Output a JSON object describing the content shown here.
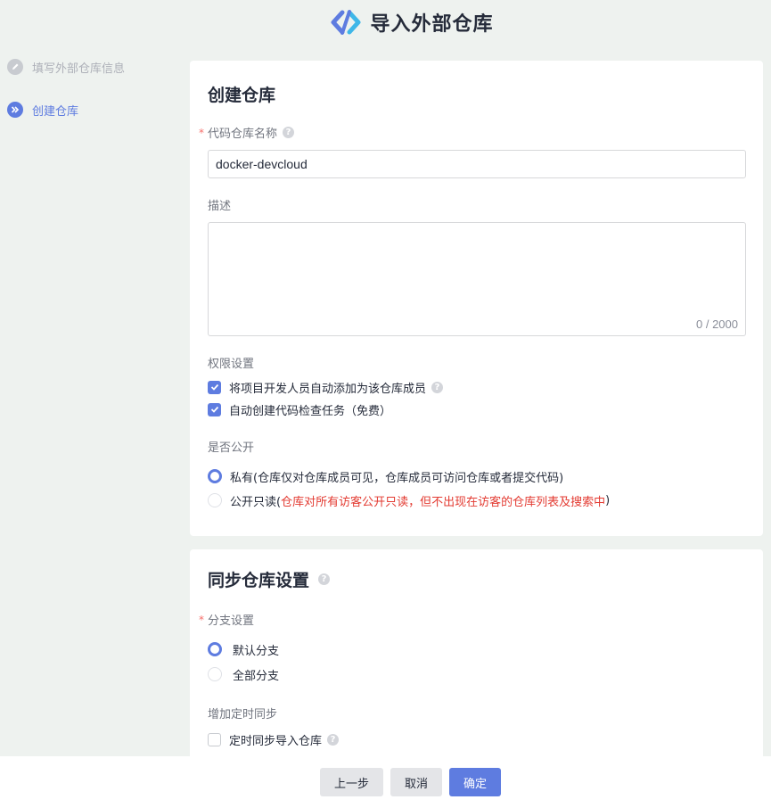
{
  "header": {
    "title": "导入外部仓库"
  },
  "steps": [
    {
      "label": "填写外部仓库信息",
      "state": "done",
      "icon": "pencil-icon"
    },
    {
      "label": "创建仓库",
      "state": "active",
      "icon": "double-chevron-right-icon"
    }
  ],
  "create": {
    "title": "创建仓库",
    "name_label": "代码仓库名称",
    "name_value": "docker-devcloud",
    "desc_label": "描述",
    "desc_count": "0 / 2000",
    "perm_label": "权限设置",
    "perm_opt1": "将项目开发人员自动添加为该仓库成员",
    "perm_opt2": "自动创建代码检查任务（免费）",
    "public_label": "是否公开",
    "private_opt": "私有(仓库仅对仓库成员可见，仓库成员可访问仓库或者提交代码)",
    "public_prefix": "公开只读(",
    "public_warn": "仓库对所有访客公开只读，但不出现在访客的仓库列表及搜索中",
    "public_suffix": " )"
  },
  "sync": {
    "title": "同步仓库设置",
    "branch_label": "分支设置",
    "branch_default": "默认分支",
    "branch_all": "全部分支",
    "timer_label": "增加定时同步",
    "timer_opt": "定时同步导入仓库"
  },
  "footer": {
    "prev": "上一步",
    "cancel": "取消",
    "confirm": "确定"
  },
  "colors": {
    "accent": "#5e7ce0",
    "warning": "#e33a31",
    "required": "#f66f6a"
  }
}
